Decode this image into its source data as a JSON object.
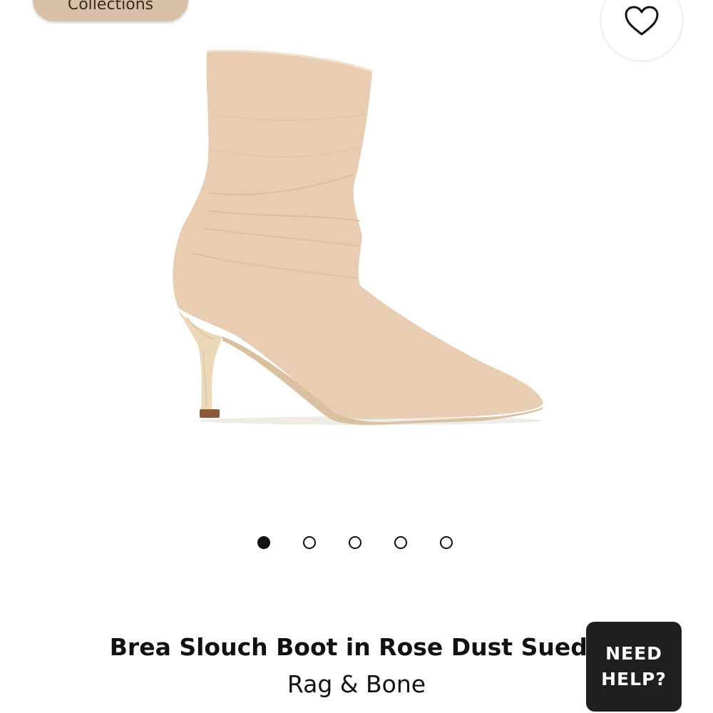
{
  "header": {
    "collections_label": "Collections",
    "wishlist_icon": "heart-outline-icon"
  },
  "product": {
    "image_alt": "Brea Slouch Boot in Rose Dust Suede",
    "title": "Brea Slouch Boot in Rose Dust Suede",
    "brand": "Rag & Bone",
    "color": "#e9cdb3"
  },
  "carousel": {
    "total": 5,
    "active_index": 0
  },
  "help": {
    "line1": "NEED",
    "line2": "HELP?"
  }
}
